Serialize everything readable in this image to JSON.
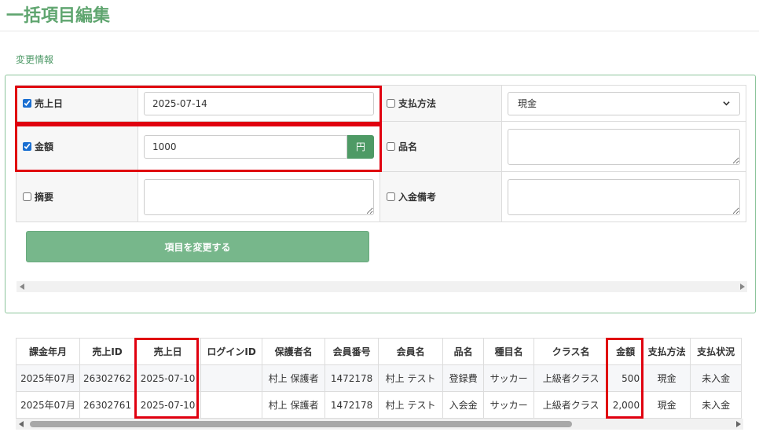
{
  "page": {
    "title": "一括項目編集"
  },
  "form": {
    "section_label": "変更情報",
    "fields": {
      "sales_date": {
        "label": "売上日",
        "checked": true,
        "value": "2025-07-14"
      },
      "payment_method": {
        "label": "支払方法",
        "checked": false,
        "selected": "現金"
      },
      "amount": {
        "label": "金額",
        "checked": true,
        "value": "1000",
        "unit": "円"
      },
      "item_name": {
        "label": "品名",
        "checked": false,
        "value": ""
      },
      "summary": {
        "label": "摘要",
        "checked": false,
        "value": ""
      },
      "deposit_note": {
        "label": "入金備考",
        "checked": false,
        "value": ""
      }
    },
    "apply_button_label": "項目を変更する"
  },
  "table": {
    "headers": [
      "課金年月",
      "売上ID",
      "売上日",
      "ログインID",
      "保護者名",
      "会員番号",
      "会員名",
      "品名",
      "種目名",
      "クラス名",
      "金額",
      "支払方法",
      "支払状況"
    ],
    "rows": [
      [
        "2025年07月",
        "26302762",
        "2025-07-10",
        "",
        "村上 保護者",
        "1472178",
        "村上 テスト",
        "登録費",
        "サッカー",
        "上級者クラス",
        "500",
        "現金",
        "未入金"
      ],
      [
        "2025年07月",
        "26302761",
        "2025-07-10",
        "",
        "村上 保護者",
        "1472178",
        "村上 テスト",
        "入会金",
        "サッカー",
        "上級者クラス",
        "2,000",
        "現金",
        "未入金"
      ]
    ]
  },
  "colors": {
    "accent": "#5fa56f",
    "button": "#77b78b",
    "highlight": "#e0000f"
  }
}
